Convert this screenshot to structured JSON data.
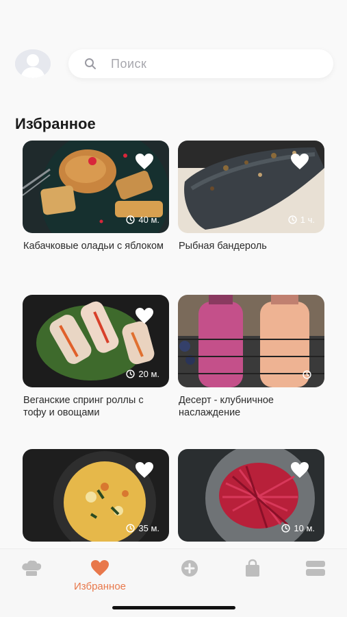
{
  "search": {
    "placeholder": "Поиск"
  },
  "section_title": "Избранное",
  "recipes": [
    {
      "name": "Кабачковые оладьи с яблоком",
      "time": "40 м."
    },
    {
      "name": "Рыбная бандероль",
      "time": "1 ч."
    },
    {
      "name": "Веганские спринг роллы с тофу и овощами",
      "time": "20 м."
    },
    {
      "name": "Десерт - клубничное наслаждение",
      "time": ""
    },
    {
      "name": "",
      "time": "35 м."
    },
    {
      "name": "",
      "time": "10 м."
    }
  ],
  "tabbar": {
    "active_label": "Избранное",
    "items": [
      "chef-hat-icon",
      "heart-icon",
      "plus-circle-icon",
      "bag-icon",
      "layers-icon"
    ]
  },
  "colors": {
    "accent": "#e8784b",
    "inactive": "#bdbdbd",
    "background": "#f9f9f9"
  }
}
